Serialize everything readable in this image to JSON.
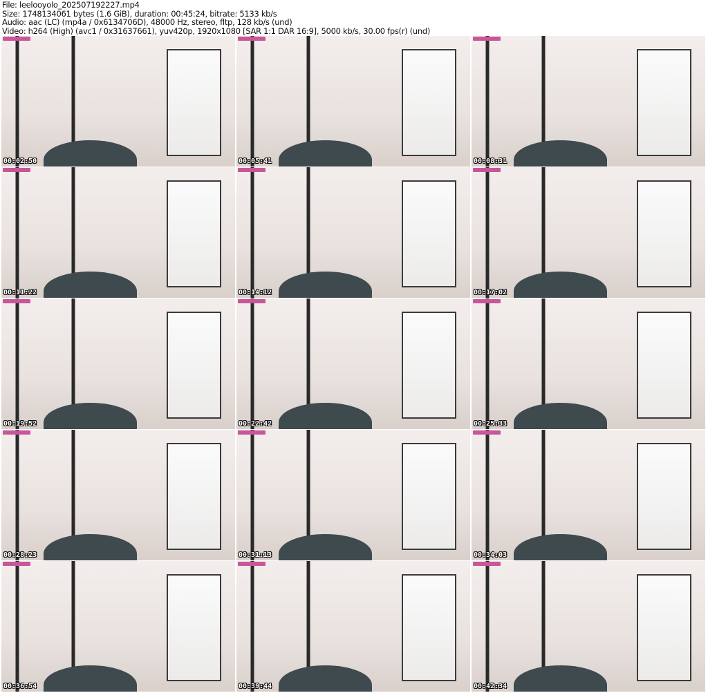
{
  "header": {
    "file": "File: leelooyolo_202507192227.mp4",
    "size": "Size: 1748134061 bytes (1.6 GiB), duration: 00:45:24, bitrate: 5133 kb/s",
    "audio": "Audio: aac (LC) (mp4a / 0x6134706D), 48000 Hz, stereo, fltp, 128 kb/s (und)",
    "video": "Video: h264 (High) (avc1 / 0x31637661), yuv420p, 1920x1080 [SAR 1:1 DAR 16:9], 5000 kb/s, 30.00 fps(r) (und)"
  },
  "thumbnails": [
    {
      "timestamp": "00:02:50"
    },
    {
      "timestamp": "00:05:41"
    },
    {
      "timestamp": "00:08:31"
    },
    {
      "timestamp": "00:11:22"
    },
    {
      "timestamp": "00:14:12"
    },
    {
      "timestamp": "00:17:02"
    },
    {
      "timestamp": "00:19:52"
    },
    {
      "timestamp": "00:22:42"
    },
    {
      "timestamp": "00:25:33"
    },
    {
      "timestamp": "00:28:23"
    },
    {
      "timestamp": "00:31:13"
    },
    {
      "timestamp": "00:34:03"
    },
    {
      "timestamp": "00:36:54"
    },
    {
      "timestamp": "00:39:44"
    },
    {
      "timestamp": "00:42:34"
    }
  ]
}
